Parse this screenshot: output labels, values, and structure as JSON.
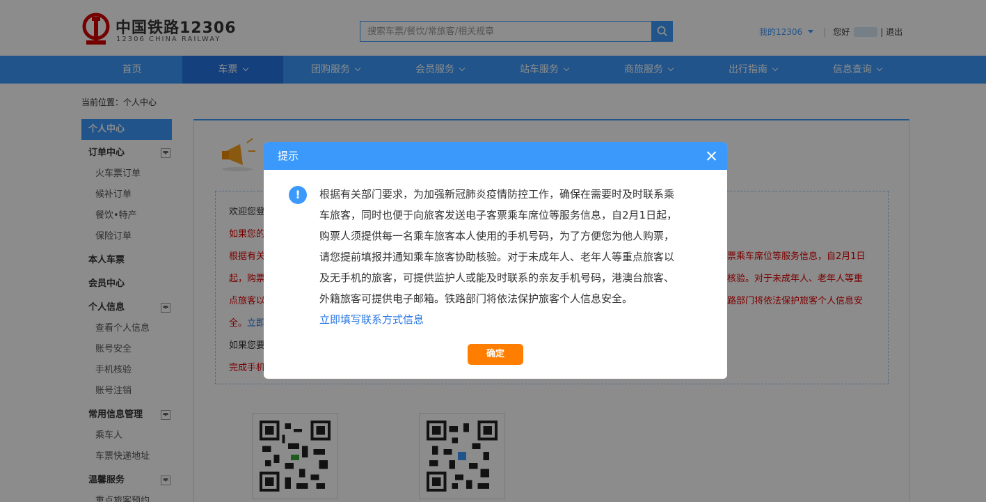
{
  "header": {
    "logo_cn": "中国铁路12306",
    "logo_en": "12306 CHINA RAILWAY",
    "search_placeholder": "搜索车票/餐饮/常旅客/相关规章",
    "my12306": "我的12306",
    "greeting": "您好",
    "logout": "| 退出"
  },
  "nav": [
    {
      "label": "首页"
    },
    {
      "label": "车票"
    },
    {
      "label": "团购服务"
    },
    {
      "label": "会员服务"
    },
    {
      "label": "站车服务"
    },
    {
      "label": "商旅服务"
    },
    {
      "label": "出行指南"
    },
    {
      "label": "信息查询"
    }
  ],
  "breadcrumb": "当前位置：个人中心",
  "sidebar": {
    "head": "个人中心",
    "items": [
      {
        "label": "订单中心"
      },
      {
        "label": "火车票订单"
      },
      {
        "label": "候补订单"
      },
      {
        "label": "餐饮•特产"
      },
      {
        "label": "保险订单"
      },
      {
        "label": "本人车票"
      },
      {
        "label": "会员中心"
      },
      {
        "label": "个人信息"
      },
      {
        "label": "查看个人信息"
      },
      {
        "label": "账号安全"
      },
      {
        "label": "手机核验"
      },
      {
        "label": "账号注销"
      },
      {
        "label": "常用信息管理"
      },
      {
        "label": "乘车人"
      },
      {
        "label": "车票快递地址"
      },
      {
        "label": "温馨服务"
      },
      {
        "label": "重点旅客预约"
      }
    ]
  },
  "main": {
    "left": [
      "欢迎您登",
      "如果您的",
      "根据有关",
      "起，购票",
      "点旅客以",
      "全。",
      "立即",
      "如果您要",
      "完成手机"
    ],
    "right": [
      "票乘车席位等服务信息，自2月1日",
      "核验。对于未成年人、老年人等重",
      "路部门将依法保护旅客个人信息安"
    ]
  },
  "dialog": {
    "title": "提示",
    "lines": [
      "根据有关部门要求，为加强新冠肺炎疫情防控工作，确保在需要时及时联系乘",
      "车旅客，同时也便于向旅客发送电子客票乘车席位等服务信息，自2月1日起，",
      "购票人须提供每一名乘车旅客本人使用的手机号码，为了方便您为他人购票，",
      "请您提前填报并通知乘车旅客协助核验。对于未成年人、老年人等重点旅客以",
      "及无手机的旅客，可提供监护人或能及时联系的亲友手机号码，港澳台旅客、",
      "外籍旅客可提供电子邮箱。铁路部门将依法保护旅客个人信息安全。"
    ],
    "link": "立即填写联系方式信息",
    "ok": "确定"
  }
}
